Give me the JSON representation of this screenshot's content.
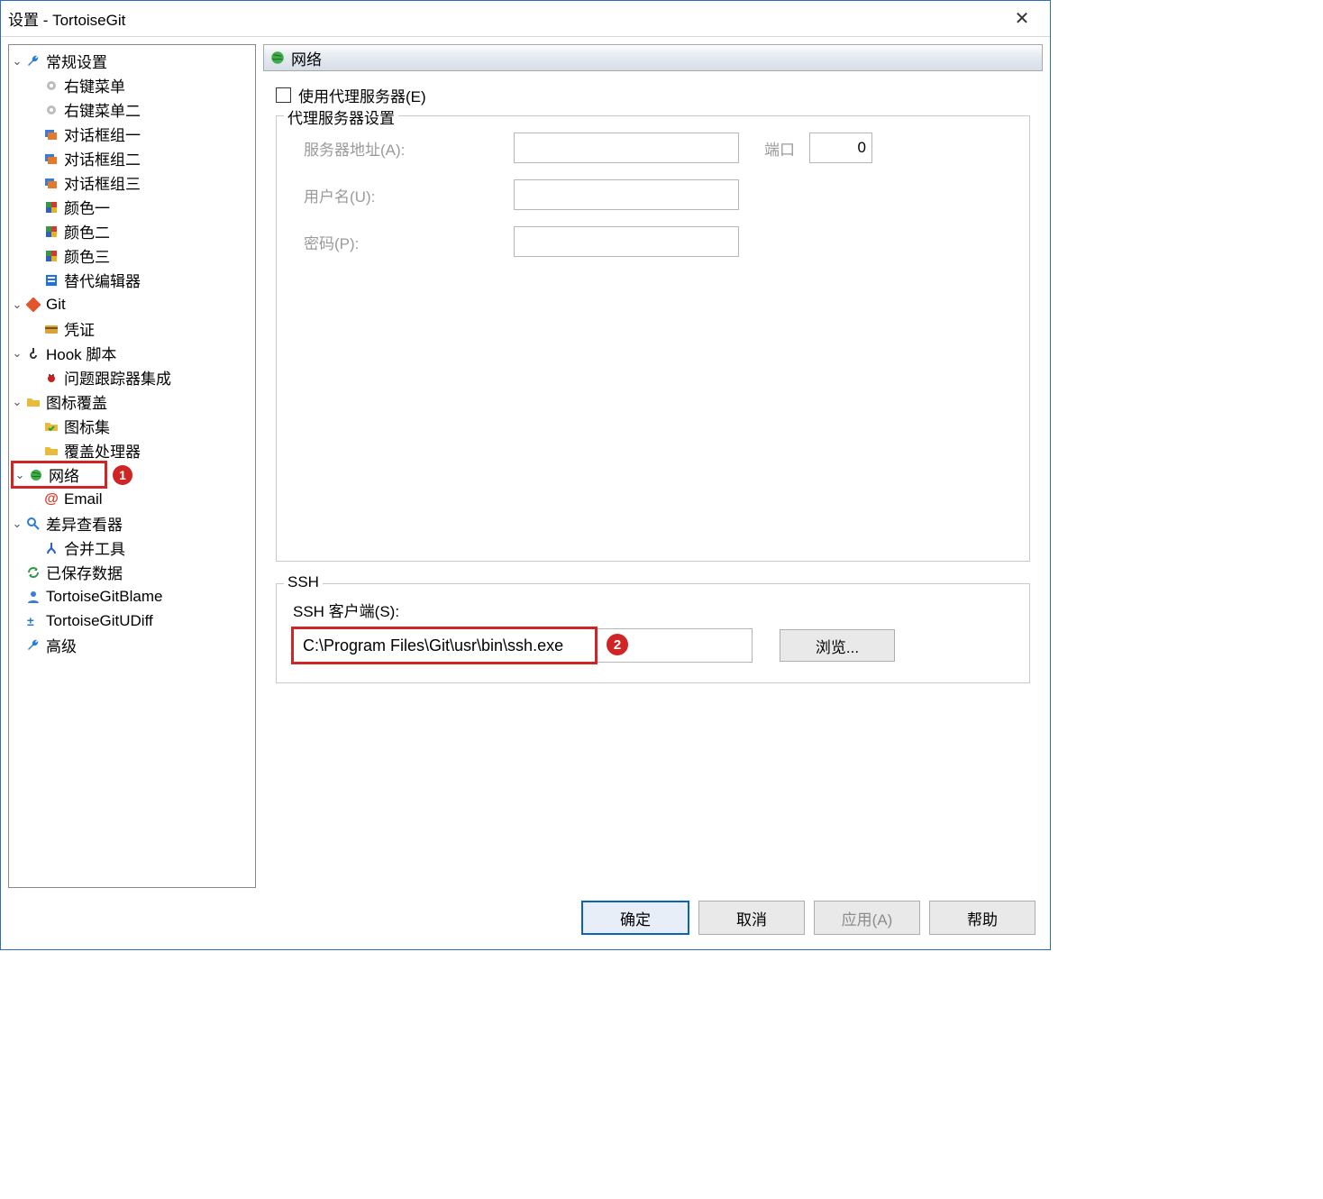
{
  "window": {
    "title": "设置 - TortoiseGit"
  },
  "panelHeader": "网络",
  "tree": {
    "general": "常规设置",
    "context": "右键菜单",
    "context2": "右键菜单二",
    "dialog1": "对话框组一",
    "dialog2": "对话框组二",
    "dialog3": "对话框组三",
    "color1": "颜色一",
    "color2": "颜色二",
    "color3": "颜色三",
    "altEditor": "替代编辑器",
    "git": "Git",
    "cred": "凭证",
    "hook": "Hook 脚本",
    "issue": "问题跟踪器集成",
    "overlay": "图标覆盖",
    "iconset": "图标集",
    "overlayHandlers": "覆盖处理器",
    "network": "网络",
    "email": "Email",
    "diff": "差异查看器",
    "merge": "合并工具",
    "saved": "已保存数据",
    "blame": "TortoiseGitBlame",
    "udiff": "TortoiseGitUDiff",
    "adv": "高级"
  },
  "proxy": {
    "useProxy": "使用代理服务器(E)",
    "settingsTitle": "代理服务器设置",
    "addrLabel": "服务器地址(A):",
    "portLabel": "端口",
    "portValue": "0",
    "userLabel": "用户名(U):",
    "passLabel": "密码(P):"
  },
  "ssh": {
    "legend": "SSH",
    "clientLabel": "SSH 客户端(S):",
    "path": "C:\\Program Files\\Git\\usr\\bin\\ssh.exe",
    "browse": "浏览..."
  },
  "buttons": {
    "ok": "确定",
    "cancel": "取消",
    "apply": "应用(A)",
    "help": "帮助"
  },
  "annotations": {
    "one": "1",
    "two": "2"
  }
}
